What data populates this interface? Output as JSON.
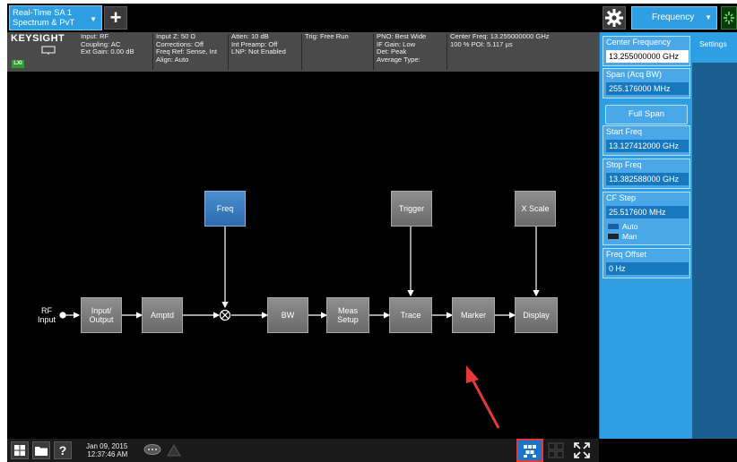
{
  "top": {
    "mode_line1": "Real-Time SA 1",
    "mode_line2": "Spectrum & PvT",
    "add_label": "+",
    "menu_label": "Frequency"
  },
  "info": {
    "brand": "KEYSIGHT",
    "lxi_badge": "LXI",
    "col1": [
      "Input: RF",
      "Coupling: AC",
      "Ext Gain: 0.00 dB"
    ],
    "col2": [
      "Input Z: 50 Ω",
      "Corrections: Off",
      "Freq Ref: Sense, Int",
      "Align: Auto"
    ],
    "col3": [
      "Atten: 10 dB",
      "Int Preamp: Off",
      "LNP: Not Enabled"
    ],
    "col4": [
      "Trig: Free Run"
    ],
    "col5": [
      "PNO: Best Wide",
      "IF Gain: Low",
      "Det: Peak",
      "Average Type:"
    ],
    "col6": [
      "Center Freq: 13.255000000 GHz",
      "100 % POI: 5.117 µs"
    ]
  },
  "diagram": {
    "rf_input": [
      "RF",
      "Input"
    ],
    "blocks": {
      "input_output": "Input/ Output",
      "amptd": "Amptd",
      "freq": "Freq",
      "bw": "BW",
      "meas_setup": "Meas Setup",
      "trigger": "Trigger",
      "trace": "Trace",
      "marker": "Marker",
      "x_scale": "X Scale",
      "display": "Display"
    }
  },
  "bottom": {
    "date": "Jan 09, 2015",
    "time": "12:37:46 AM"
  },
  "softkeys": {
    "settings_tab": "Settings",
    "center_freq": {
      "label": "Center Frequency",
      "value": "13.255000000 GHz"
    },
    "span": {
      "label": "Span (Acq BW)",
      "value": "255.176000 MHz"
    },
    "full_span": "Full Span",
    "start_freq": {
      "label": "Start Freq",
      "value": "13.127412000 GHz"
    },
    "stop_freq": {
      "label": "Stop Freq",
      "value": "13.382588000 GHz"
    },
    "cf_step": {
      "label": "CF Step",
      "value": "25.517600 MHz",
      "auto": "Auto",
      "man": "Man"
    },
    "freq_offset": {
      "label": "Freq Offset",
      "value": "0 Hz"
    }
  },
  "colors": {
    "accent_blue": "#2f9fe3",
    "highlight_red": "#e23a3a"
  }
}
